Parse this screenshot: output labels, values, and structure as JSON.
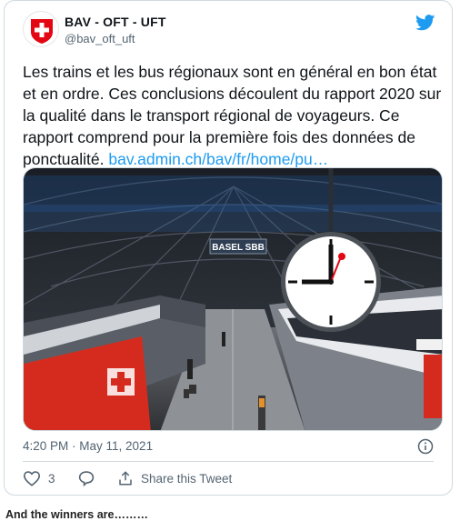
{
  "account": {
    "name": "BAV - OFT - UFT",
    "handle": "@bav_oft_uft",
    "avatar_icon": "swiss-cross-icon",
    "platform_icon": "twitter-bird-icon"
  },
  "tweet": {
    "text": "Les trains et les bus régionaux sont en général en bon état et en ordre. Ces conclusions découlent du rapport 2020 sur la qualité dans le transport régional de voyageurs. Ce rapport comprend pour la première fois des données de ponctualité. ",
    "link": "bav.admin.ch/bav/fr/home/pu…",
    "timestamp": "4:20 PM · May 11, 2021",
    "image_sign": "BASEL SBB"
  },
  "actions": {
    "like_count": "3",
    "share_label": "Share this Tweet"
  },
  "caption": "And the winners are………",
  "colors": {
    "accent": "#1d9bf0",
    "swiss_red": "#e30613",
    "train_red": "#d52b1e"
  }
}
